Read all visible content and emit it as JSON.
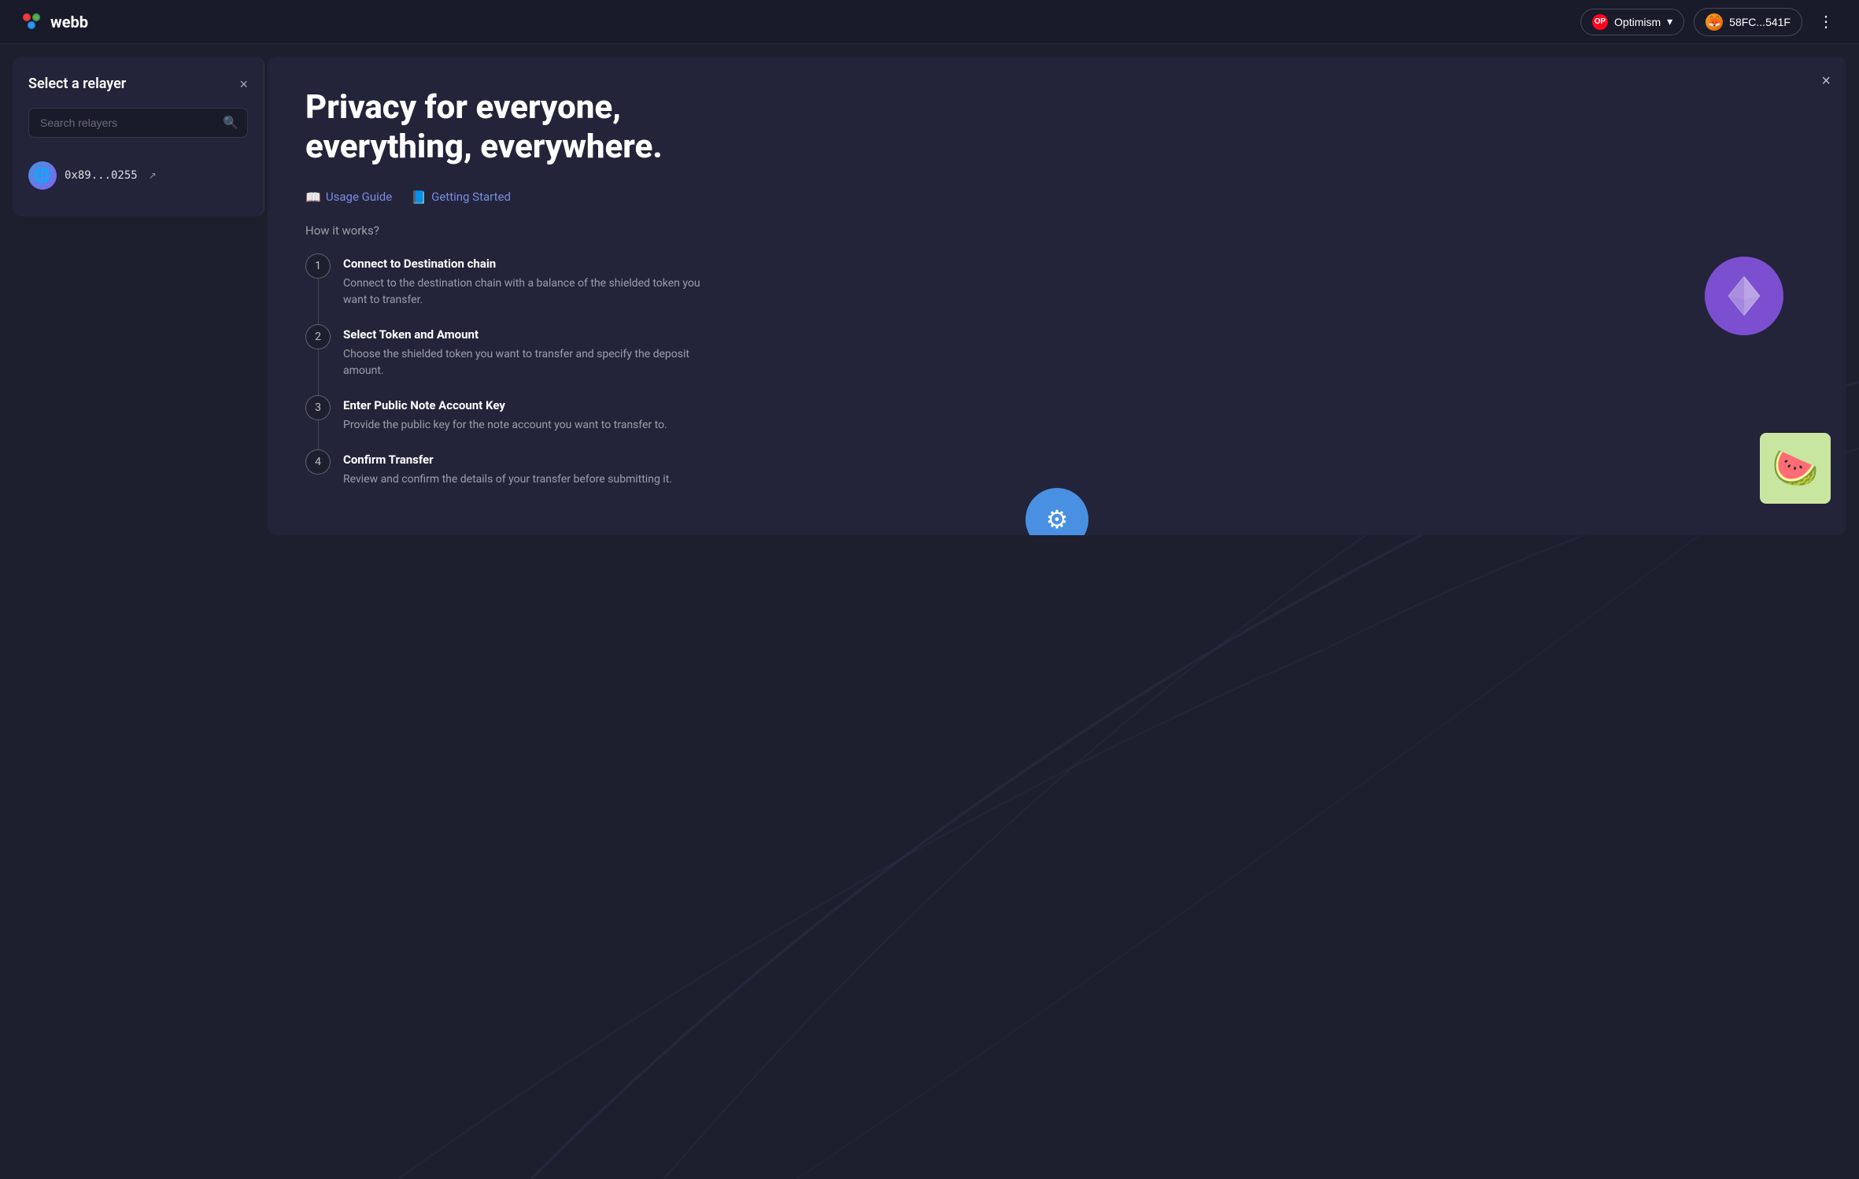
{
  "app": {
    "logo_text": "webb"
  },
  "header": {
    "network_label": "Optimism",
    "network_chevron": "▾",
    "wallet_address": "58FC...541F",
    "more_icon": "⋮"
  },
  "relayer_panel": {
    "title": "Select a relayer",
    "close_icon": "×",
    "search_placeholder": "Search relayers",
    "relayer_address": "0x89...0255",
    "external_link_icon": "↗"
  },
  "info_modal": {
    "title": "Privacy for everyone, everything, everywhere.",
    "close_icon": "×",
    "tabs": [
      {
        "label": "Usage Guide",
        "icon": "📖"
      },
      {
        "label": "Getting Started",
        "icon": "📘"
      }
    ],
    "how_it_works_label": "How it works?",
    "steps": [
      {
        "number": "1",
        "title": "Connect to Destination chain",
        "description": "Connect to the destination chain with a balance of the shielded token you want to transfer."
      },
      {
        "number": "2",
        "title": "Select Token and Amount",
        "description": "Choose the shielded token you want to transfer and specify the deposit amount."
      },
      {
        "number": "3",
        "title": "Enter Public Note Account Key",
        "description": "Provide the public key for the note account you want to transfer to."
      },
      {
        "number": "4",
        "title": "Confirm Transfer",
        "description": "Review and confirm the details of your transfer before submitting it."
      }
    ]
  }
}
